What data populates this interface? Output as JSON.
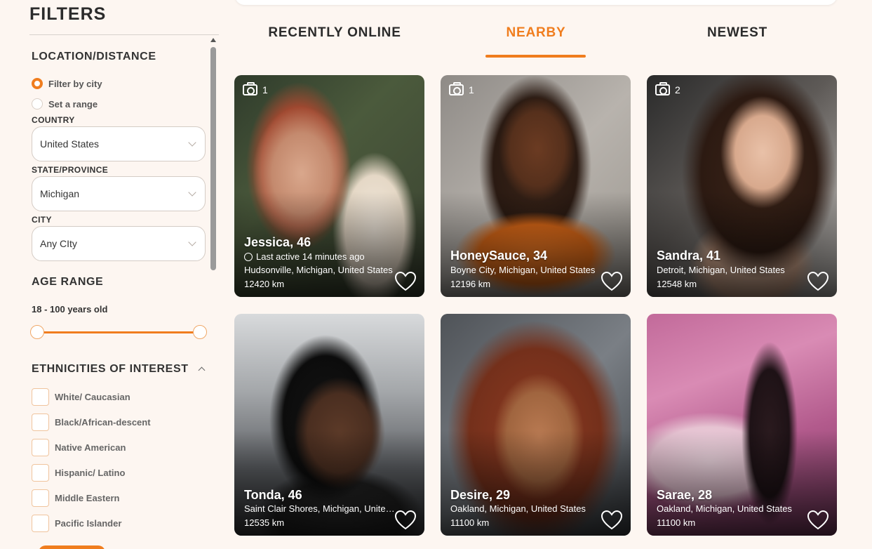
{
  "sidebar": {
    "title": "FILTERS",
    "location": {
      "heading": "LOCATION/DISTANCE",
      "options": [
        {
          "label": "Filter by city",
          "selected": true
        },
        {
          "label": "Set a range",
          "selected": false
        }
      ],
      "country_label": "COUNTRY",
      "country_value": "United States",
      "state_label": "STATE/PROVINCE",
      "state_value": "Michigan",
      "city_label": "CITY",
      "city_value": "Any CIty"
    },
    "age": {
      "heading": "AGE RANGE",
      "range_text": "18 - 100 years old",
      "min": 18,
      "max": 100
    },
    "ethnicities": {
      "heading": "ETHNICITIES OF INTEREST",
      "items": [
        "White/ Caucasian",
        "Black/African-descent",
        "Native American",
        "Hispanic/ Latino",
        "Middle Eastern",
        "Pacific Islander"
      ]
    }
  },
  "tabs": [
    {
      "label": "RECENTLY ONLINE"
    },
    {
      "label": "NEARBY",
      "active": true
    },
    {
      "label": "NEWEST"
    }
  ],
  "profiles": [
    {
      "photos": "1",
      "name": "Jessica, 46",
      "status": "Last active 14 minutes ago",
      "location": "Hudsonville, Michigan, United States",
      "distance": "12420 km"
    },
    {
      "photos": "1",
      "name": "HoneySauce, 34",
      "location": "Boyne City, Michigan, United States",
      "distance": "12196 km"
    },
    {
      "photos": "2",
      "name": "Sandra, 41",
      "location": "Detroit, Michigan, United States",
      "distance": "12548 km"
    },
    {
      "name": "Tonda, 46",
      "location": "Saint Clair Shores, Michigan, United States",
      "distance": "12535 km"
    },
    {
      "name": "Desire, 29",
      "location": "Oakland, Michigan, United States",
      "distance": "11100 km"
    },
    {
      "name": "Sarae, 28",
      "location": "Oakland, Michigan, United States",
      "distance": "11100 km"
    }
  ],
  "colors": {
    "accent": "#f07d1e",
    "background": "#fdf6f1"
  }
}
